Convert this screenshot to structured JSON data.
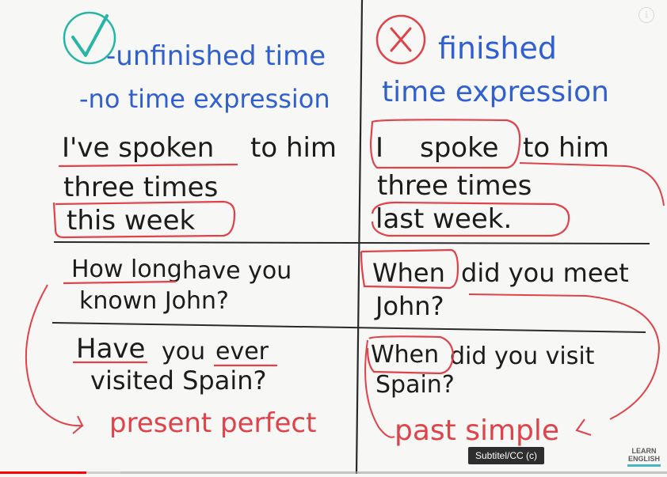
{
  "board": {
    "left_top": {
      "line1": "-unfinished time",
      "line2": "-no time expression"
    },
    "right_top": {
      "line1": "finished",
      "line2": "time expression"
    },
    "left_example1": {
      "line1_a": "I've spoken",
      "line1_b": "to him",
      "line2": "three times",
      "line3": "this week"
    },
    "right_example1": {
      "line1_a": "I",
      "line1_b": "spoke",
      "line1_c": "to him",
      "line2": "three times",
      "line3": "last week."
    },
    "left_example2": {
      "line1_a": "How long",
      "line1_b": "have you",
      "line2": "known John?"
    },
    "right_example2": {
      "line1_a": "When",
      "line1_b": "did you meet",
      "line2": "John?"
    },
    "left_example3": {
      "line1_a": "Have",
      "line1_b": "you",
      "line1_c": "ever",
      "line2": "visited Spain?"
    },
    "right_example3": {
      "line1_a": "When",
      "line1_b": "did you visit",
      "line2": "Spain?"
    },
    "left_label": "present perfect",
    "right_label": "past simple"
  },
  "player": {
    "info_label": "i",
    "tooltip": "Subtitel/CC (c)",
    "progress_played": 0.13,
    "progress_buffered": 0.18
  },
  "brand": {
    "logo_line1": "LEARN",
    "logo_line2": "ENGLISH"
  },
  "colors": {
    "ink": "#1c1c1c",
    "blue": "#2f5fd0",
    "red": "#e0424a",
    "green": "#27b5a5"
  }
}
